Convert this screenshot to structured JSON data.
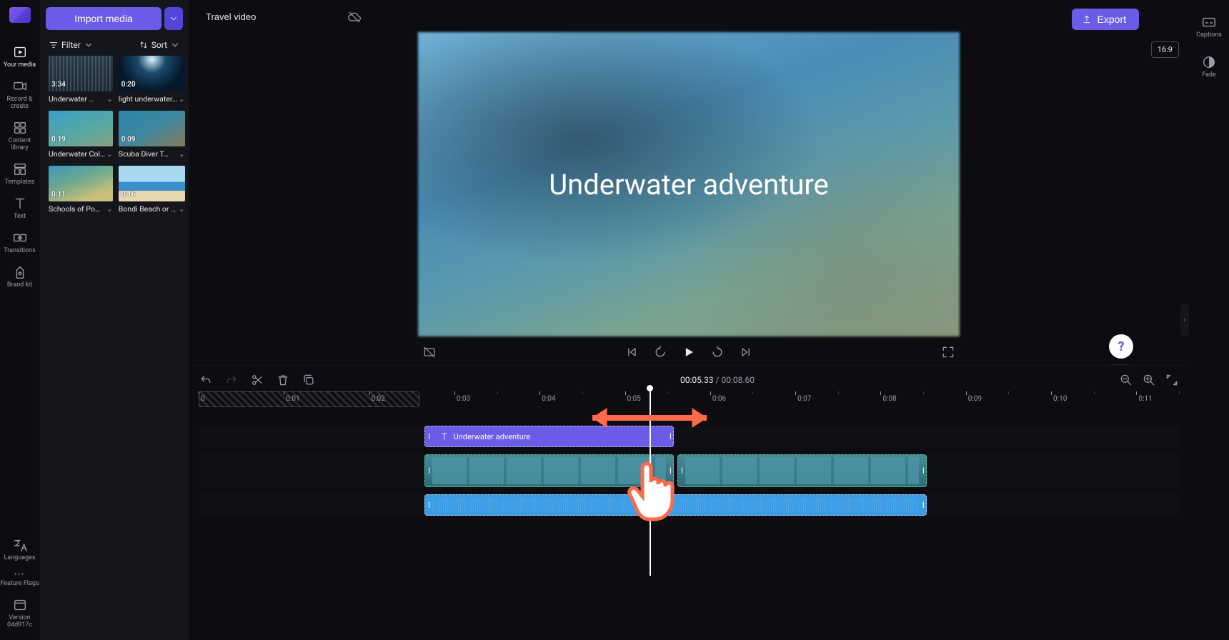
{
  "header": {
    "project_name": "Travel video",
    "import_label": "Import media",
    "export_label": "Export",
    "aspect_label": "16:9"
  },
  "left_rail": {
    "items": [
      {
        "id": "your-media",
        "label": "Your media"
      },
      {
        "id": "record-create",
        "label": "Record & create"
      },
      {
        "id": "content-library",
        "label": "Content library"
      },
      {
        "id": "templates",
        "label": "Templates"
      },
      {
        "id": "text",
        "label": "Text"
      },
      {
        "id": "transitions",
        "label": "Transitions"
      },
      {
        "id": "brand-kit",
        "label": "Brand kit"
      }
    ],
    "bottom_items": [
      {
        "id": "languages",
        "label": "Languages"
      },
      {
        "id": "feature-flags",
        "label": "Feature Flags"
      },
      {
        "id": "version",
        "label": "Version 04d917c"
      }
    ]
  },
  "right_rail": {
    "items": [
      {
        "id": "captions",
        "label": "Captions"
      },
      {
        "id": "fade",
        "label": "Fade"
      }
    ]
  },
  "media_panel": {
    "filter_label": "Filter",
    "sort_label": "Sort",
    "clips": [
      {
        "duration": "3:34",
        "name": "Underwater …",
        "thumb": "t0"
      },
      {
        "duration": "0:20",
        "name": "light underwater…",
        "thumb": "t1"
      },
      {
        "duration": "0:19",
        "name": "Underwater Col…",
        "thumb": "t2"
      },
      {
        "duration": "0:09",
        "name": "Scuba Diver T…",
        "thumb": "t3"
      },
      {
        "duration": "0:11",
        "name": "Schools of Po…",
        "thumb": "t4"
      },
      {
        "duration": "0:16",
        "name": "Bondi Beach or …",
        "thumb": "t5"
      }
    ]
  },
  "preview": {
    "overlay_text": "Underwater adventure"
  },
  "timeline": {
    "current": "00:05.33",
    "total": "00:08.60",
    "playhead_pct": 46.0,
    "hatch_end_pct": 22.5,
    "ruler_marks": [
      "0",
      "0:01",
      "0:02",
      "0:03",
      "0:04",
      "0:05",
      "0:06",
      "0:07",
      "0:08",
      "0:09",
      "0:10",
      "0:11"
    ],
    "text_clip": {
      "label": "Underwater adventure",
      "start_pct": 23.0,
      "width_pct": 25.5
    },
    "video_clips": [
      {
        "start_pct": 23.0,
        "width_pct": 25.5
      },
      {
        "start_pct": 48.8,
        "width_pct": 25.5
      }
    ],
    "audio_clip": {
      "start_pct": 23.0,
      "width_pct": 51.3
    }
  }
}
